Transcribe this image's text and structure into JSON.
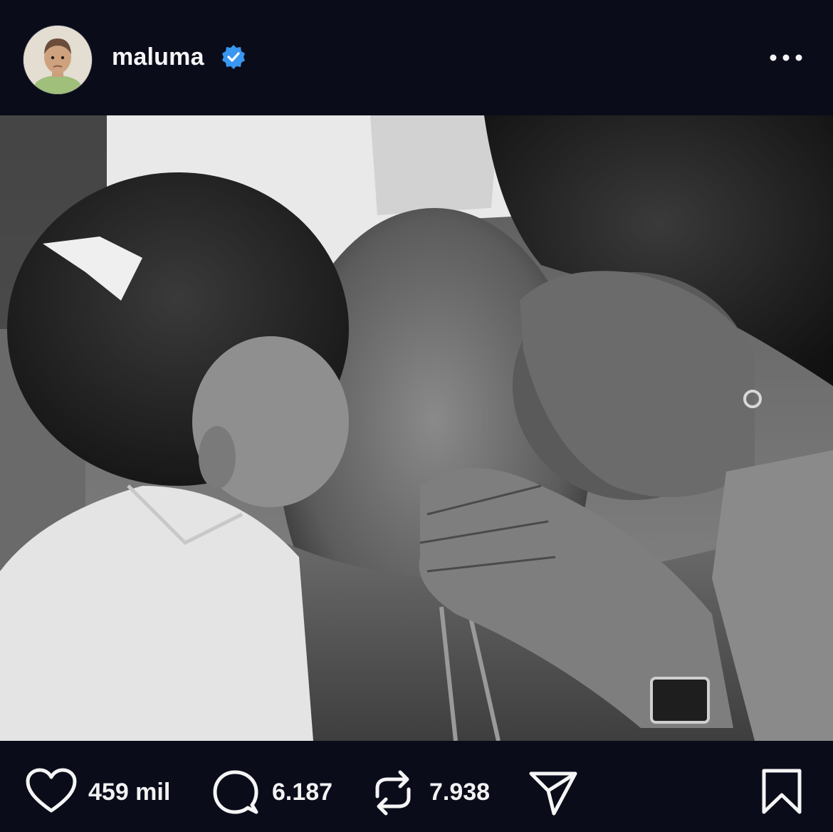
{
  "post_header": {
    "username": "maluma",
    "verified": true,
    "avatar_icon": "child-portrait-avatar",
    "more_icon": "more-horizontal-icon"
  },
  "post_media": {
    "style": "black-and-white photo"
  },
  "actions": {
    "like_count": "459 mil",
    "comment_count": "6.187",
    "repost_count": "7.938",
    "like_icon": "heart-icon",
    "comment_icon": "comment-bubble-icon",
    "repost_icon": "repost-icon",
    "share_icon": "send-icon",
    "save_icon": "bookmark-icon"
  },
  "colors": {
    "background": "#0b0c1a",
    "verified_badge": "#3897f0",
    "text": "#f5f5f5"
  }
}
